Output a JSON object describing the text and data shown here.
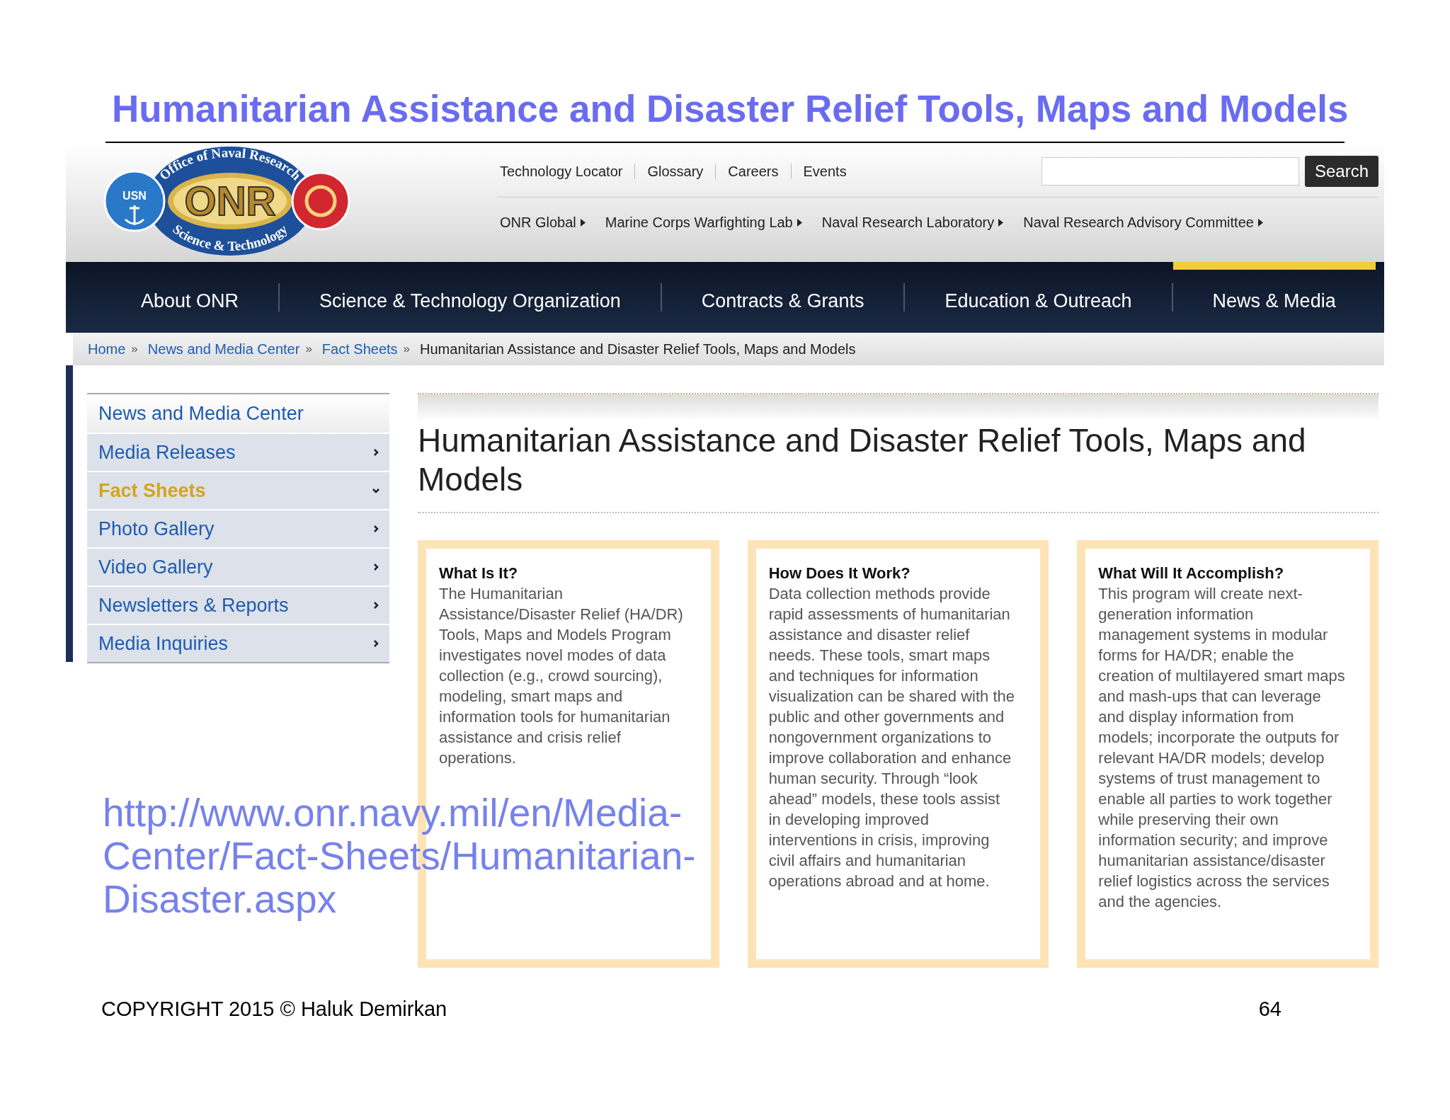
{
  "slide_title": "Humanitarian Assistance and Disaster Relief Tools, Maps and Models",
  "site": {
    "logo": {
      "top_text": "Office of Naval Research",
      "center_text": "ONR",
      "bottom_text": "Science & Technology",
      "badge_text": "USN"
    },
    "utility_links": [
      "Technology Locator",
      "Glossary",
      "Careers",
      "Events"
    ],
    "search": {
      "button": "Search"
    },
    "partner_links": [
      "ONR Global",
      "Marine Corps Warfighting Lab",
      "Naval Research Laboratory",
      "Naval Research Advisory Committee"
    ],
    "main_nav": [
      {
        "label": "About ONR",
        "selected": false
      },
      {
        "label": "Science & Technology Organization",
        "selected": false
      },
      {
        "label": "Contracts & Grants",
        "selected": false
      },
      {
        "label": "Education & Outreach",
        "selected": false
      },
      {
        "label": "News & Media",
        "selected": true
      }
    ],
    "breadcrumb": {
      "separator": "»",
      "items": [
        {
          "label": "Home",
          "kind": "link"
        },
        {
          "label": "News and Media Center",
          "kind": "link"
        },
        {
          "label": "Fact Sheets",
          "kind": "link"
        },
        {
          "label": "Humanitarian Assistance and Disaster Relief Tools, Maps and Models",
          "kind": "current"
        }
      ]
    },
    "sidebar": {
      "heading": "News and Media Center",
      "items": [
        {
          "label": "Media Releases",
          "selected": false,
          "expanded": false
        },
        {
          "label": "Fact Sheets",
          "selected": true,
          "expanded": true
        },
        {
          "label": "Photo Gallery",
          "selected": false,
          "expanded": false
        },
        {
          "label": "Video Gallery",
          "selected": false,
          "expanded": false
        },
        {
          "label": "Newsletters & Reports",
          "selected": false,
          "expanded": false
        },
        {
          "label": "Media Inquiries",
          "selected": false,
          "expanded": false
        }
      ]
    },
    "page_title": "Humanitarian Assistance and Disaster Relief Tools, Maps and Models",
    "columns": [
      {
        "heading": "What Is It?",
        "body": "The Humanitarian Assistance/Disaster Relief (HA/DR) Tools, Maps and Models Program investigates novel modes of data collection (e.g., crowd sourcing), modeling, smart maps and information tools for humanitarian assistance and crisis relief operations."
      },
      {
        "heading": "How Does It Work?",
        "body": "Data collection methods provide rapid assessments of humanitarian assistance and disaster relief needs. These tools, smart maps and techniques for information visualization can be shared with the public and other governments and nongovernment organizations to improve collaboration and enhance human security. Through “look ahead” models, these tools assist in developing improved interventions in crisis, improving civil affairs and humanitarian operations abroad and at home."
      },
      {
        "heading": "What Will It Accomplish?",
        "body": "This program will create next-generation information management systems in modular forms for HA/DR; enable the creation of multilayered smart maps and mash-ups that can leverage and display information from models; incorporate the outputs for relevant HA/DR models; develop systems of trust management to enable all parties to work together while preserving their own information security; and improve humanitarian assistance/disaster relief logistics across the services and the agencies."
      }
    ]
  },
  "url_overlay": "http://www.onr.navy.mil/en/Media-Center/Fact-Sheets/Humanitarian-Disaster.aspx",
  "footer": {
    "copyright": "COPYRIGHT 2015 © Haluk Demirkan",
    "page_number": "64"
  }
}
